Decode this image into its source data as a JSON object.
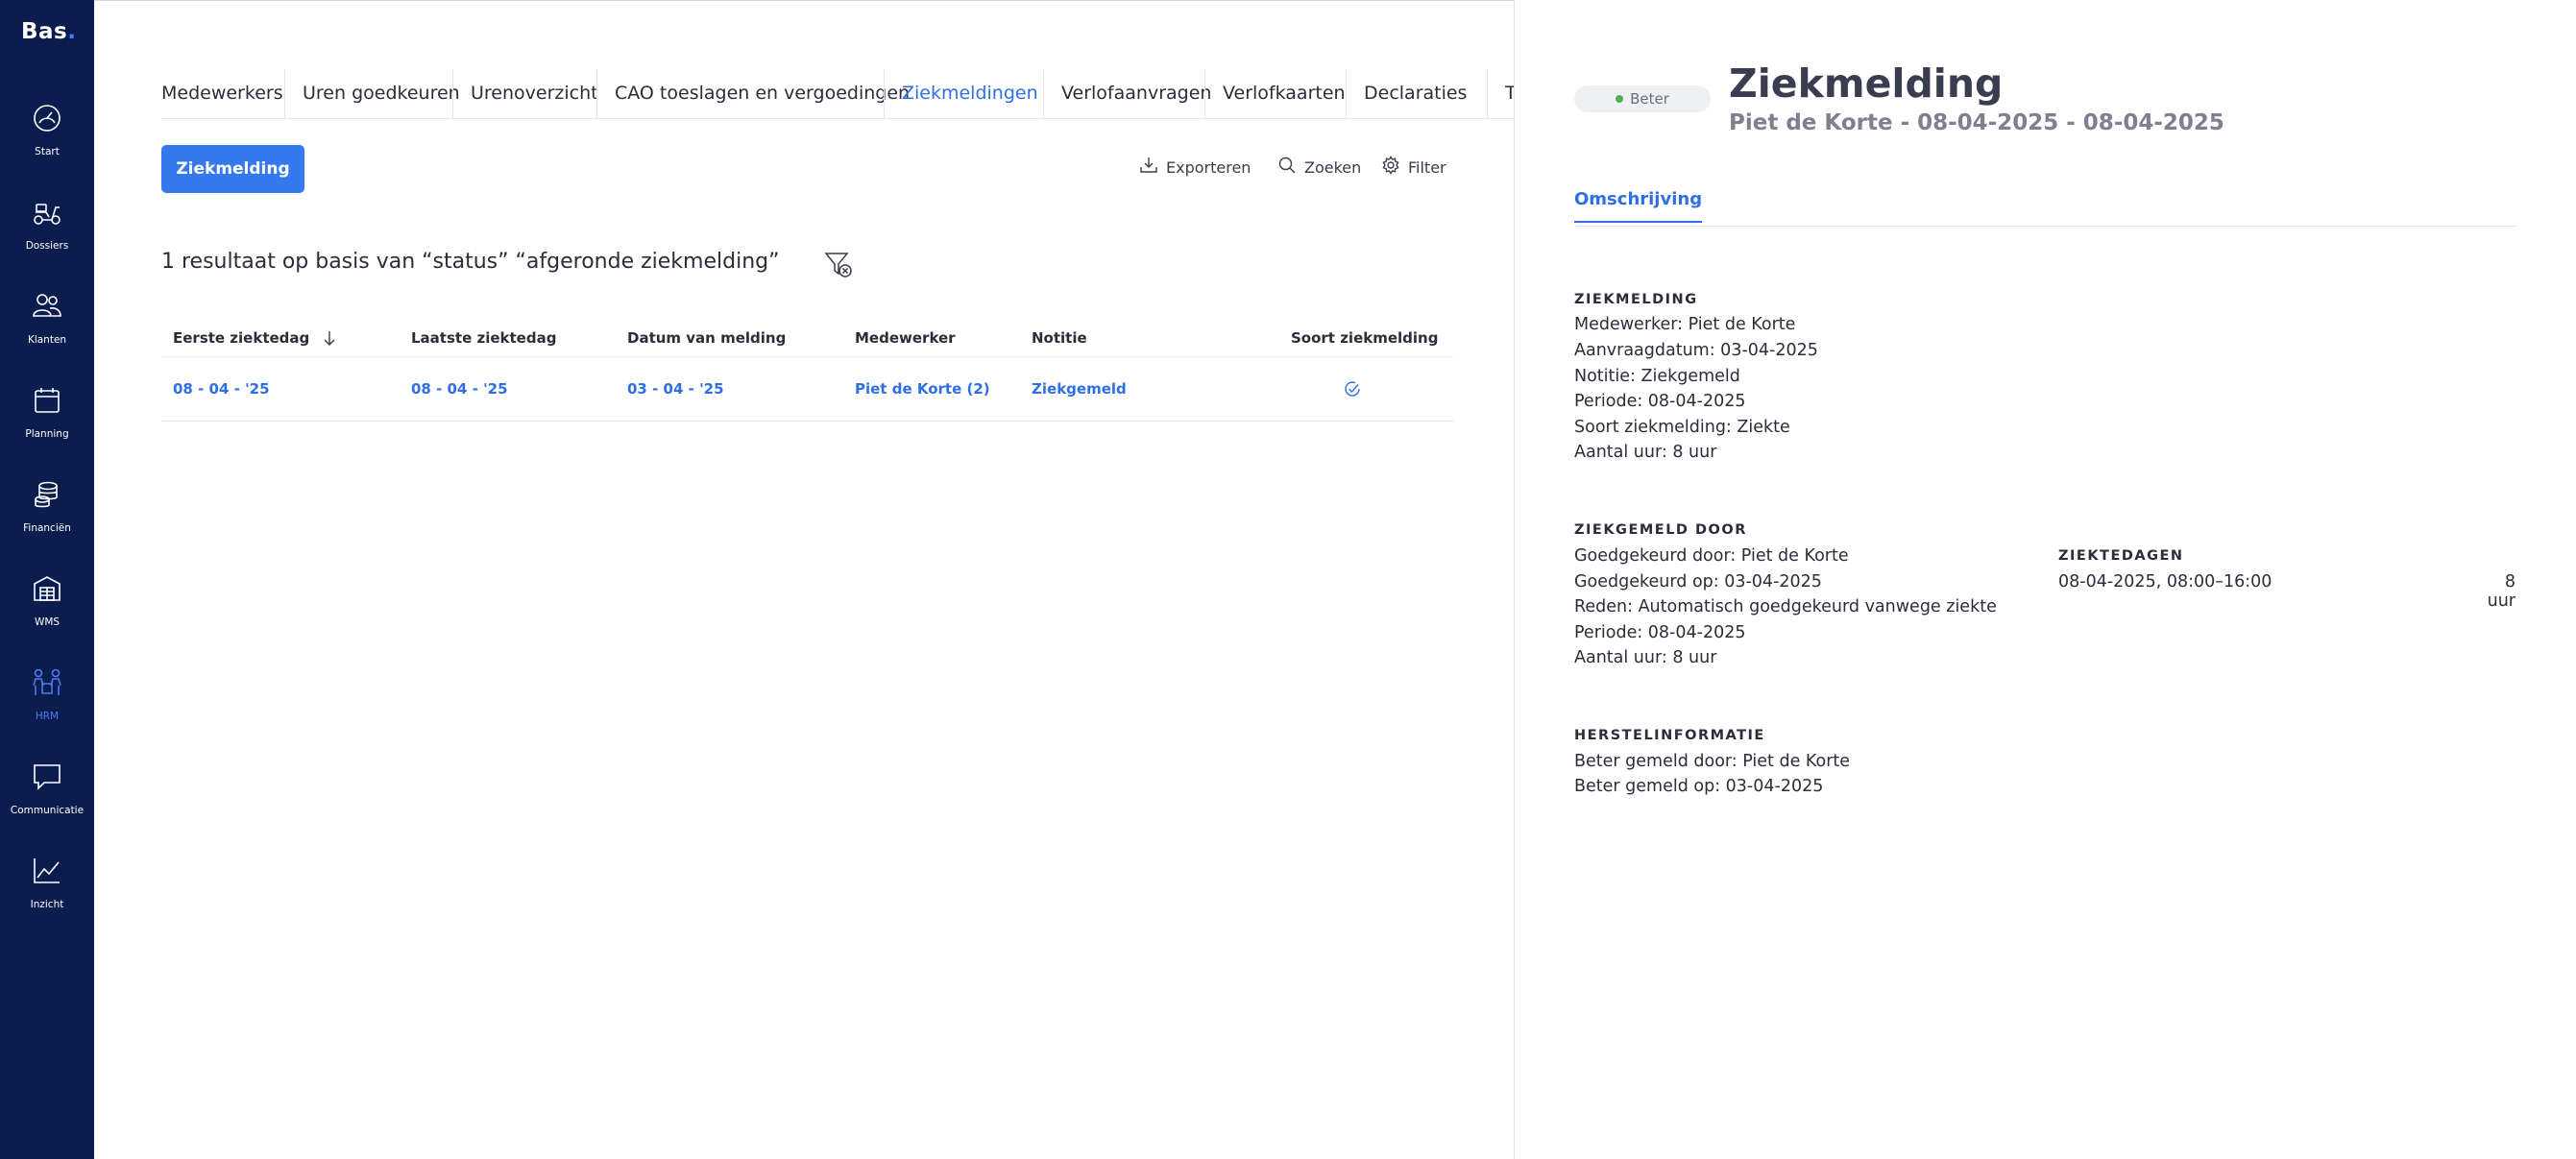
{
  "app": {
    "logo": "Bas",
    "logo_dot": "."
  },
  "sidebar": {
    "items": [
      {
        "label": "Start",
        "icon": "dashboard-gauge-icon"
      },
      {
        "label": "Dossiers",
        "icon": "scooter-icon"
      },
      {
        "label": "Klanten",
        "icon": "customers-icon"
      },
      {
        "label": "Planning",
        "icon": "calendar-icon"
      },
      {
        "label": "Financiën",
        "icon": "coins-icon"
      },
      {
        "label": "WMS",
        "icon": "warehouse-icon"
      },
      {
        "label": "HRM",
        "icon": "people-meeting-icon",
        "active": true
      },
      {
        "label": "Communicatie",
        "icon": "chat-bubble-icon"
      },
      {
        "label": "Inzicht",
        "icon": "line-chart-icon"
      }
    ],
    "active_color": "#4a7df0",
    "background": "#0b1d4e"
  },
  "tabs": [
    {
      "label": "Medewerkers"
    },
    {
      "label": "Uren goedkeuren"
    },
    {
      "label": "Urenoverzicht"
    },
    {
      "label": "CAO toeslagen en vergoedingen"
    },
    {
      "label": "Ziekmeldingen",
      "active": true
    },
    {
      "label": "Verlofaanvragen"
    },
    {
      "label": "Verlofkaarten"
    },
    {
      "label": "Declaraties"
    },
    {
      "label": "Tea"
    }
  ],
  "toolbar": {
    "new_button": "Ziekmelding",
    "export": "Exporteren",
    "search": "Zoeken",
    "filter": "Filter"
  },
  "result_text": "1 resultaat op basis van “status” “afgeronde ziekmelding”",
  "table": {
    "headers": [
      "Eerste ziektedag",
      "Laatste ziektedag",
      "Datum van melding",
      "Medewerker",
      "Notitie",
      "Soort ziekmelding"
    ],
    "rows": [
      {
        "first_day": "08 - 04 - '25",
        "last_day": "08 - 04 - '25",
        "reported": "03 - 04 - '25",
        "employee": "Piet de Korte (2)",
        "note": "Ziekgemeld",
        "type_icon": "recovered-check-icon"
      }
    ]
  },
  "detail": {
    "status_badge": "Beter",
    "title": "Ziekmelding",
    "subtitle": "Piet de Korte - 08-04-2025 - 08-04-2025",
    "tab": "Omschrijving",
    "ziekmelding": {
      "heading": "ZIEKMELDING",
      "lines": [
        "Medewerker: Piet de Korte",
        "Aanvraagdatum: 03-04-2025",
        "Notitie: Ziekgemeld",
        "Periode: 08-04-2025",
        "Soort ziekmelding: Ziekte",
        "Aantal uur: 8 uur"
      ]
    },
    "ziekgemeld_door": {
      "heading": "ZIEKGEMELD DOOR",
      "lines": [
        "Goedgekeurd door: Piet de Korte",
        "Goedgekeurd op: 03-04-2025",
        "Reden: Automatisch goedgekeurd vanwege ziekte",
        "Periode: 08-04-2025",
        "Aantal uur: 8 uur"
      ]
    },
    "ziektedagen": {
      "heading": "ZIEKTEDAGEN",
      "entry": "08-04-2025, 08:00–16:00",
      "hours": "8 uur"
    },
    "herstel": {
      "heading": "HERSTELINFORMATIE",
      "lines": [
        "Beter gemeld door: Piet de Korte",
        "Beter gemeld op: 03-04-2025"
      ]
    }
  }
}
